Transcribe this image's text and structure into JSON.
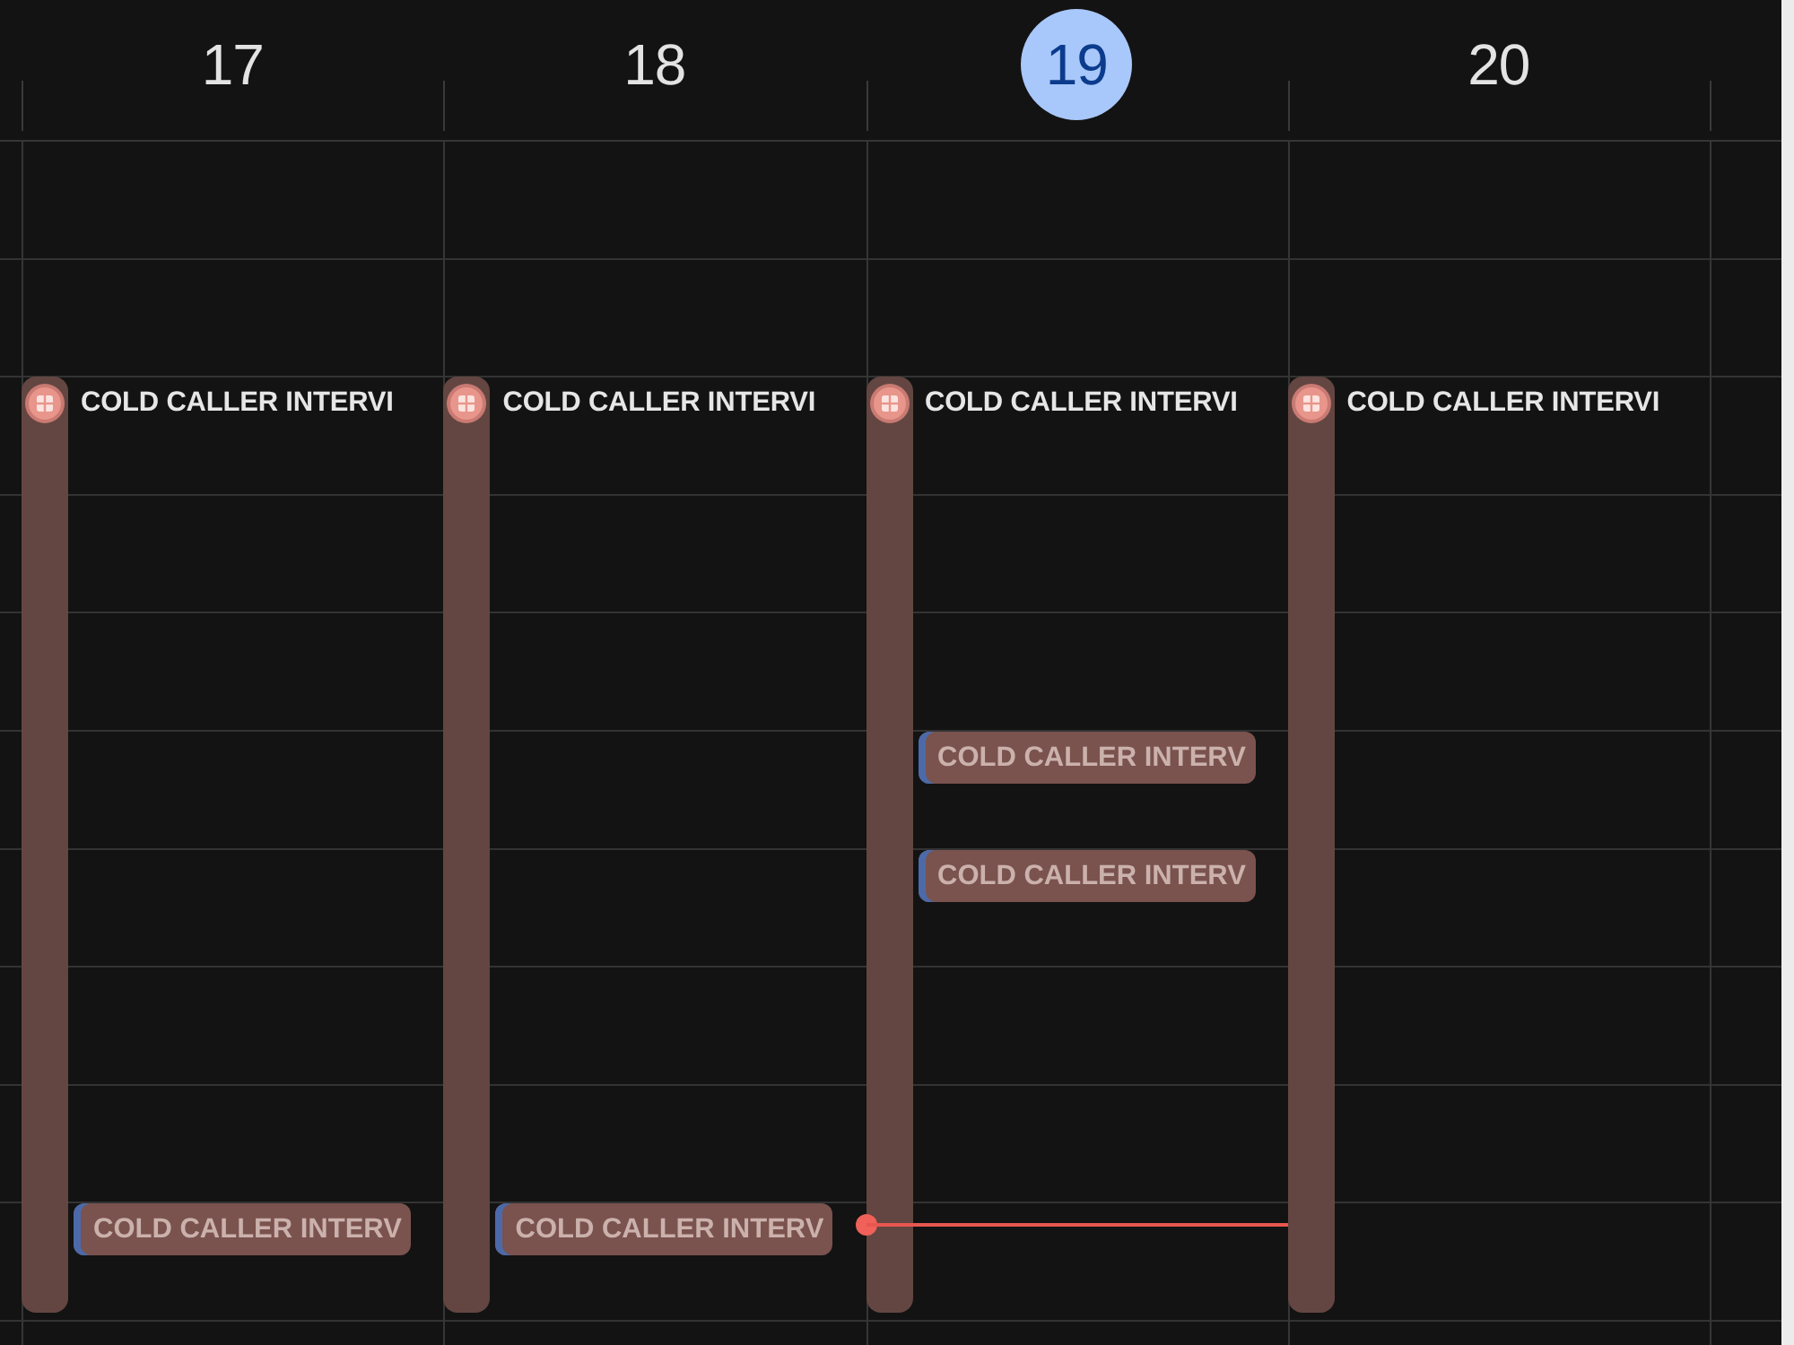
{
  "days": [
    {
      "date": "17",
      "selected": false,
      "now_line": false,
      "events": [
        {
          "kind": "tall",
          "title": "COLD CALLER INTERVI"
        },
        {
          "kind": "chip",
          "title": "COLD CALLER INTERV"
        }
      ]
    },
    {
      "date": "18",
      "selected": false,
      "now_line": false,
      "events": [
        {
          "kind": "tall",
          "title": "COLD CALLER INTERVI"
        },
        {
          "kind": "chip",
          "title": "COLD CALLER INTERV"
        }
      ]
    },
    {
      "date": "19",
      "selected": true,
      "now_line": true,
      "events": [
        {
          "kind": "tall",
          "title": "COLD CALLER INTERVI"
        },
        {
          "kind": "chip",
          "title": "COLD CALLER INTERV"
        },
        {
          "kind": "chip",
          "title": "COLD CALLER INTERV"
        }
      ]
    },
    {
      "date": "20",
      "selected": false,
      "now_line": false,
      "events": [
        {
          "kind": "tall",
          "title": "COLD CALLER INTERVI"
        }
      ]
    }
  ]
}
